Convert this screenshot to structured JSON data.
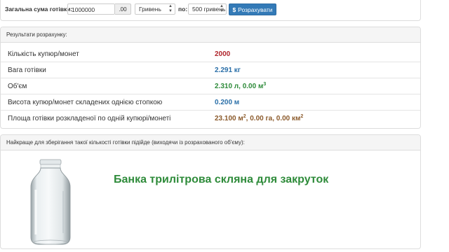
{
  "form": {
    "amount_label": "Загальна сума готівки:",
    "amount_value": "1000000",
    "decimals": ".00",
    "currency_selected": "Гривень",
    "by_label": "по:",
    "denomination_selected": "500 гривень",
    "calculate_label": "Розрахувати",
    "calculate_icon": "$"
  },
  "results": {
    "heading": "Результати розрахунку:",
    "rows": [
      {
        "label": "Кількість купюр/монет",
        "value": "2000",
        "color": "#b0262d"
      },
      {
        "label": "Вага готівки",
        "value": "2.291 кг",
        "color": "#2a6fa8"
      },
      {
        "label": "Об'єм",
        "value_main": "2.310 л, 0.00 м",
        "sup": "3",
        "color": "#2e8b3a"
      },
      {
        "label": "Висота купюр/монет складених однією стопкою",
        "value": "0.200 м",
        "color": "#2a6fa8"
      },
      {
        "label": "Площа готівки розкладеної по одній купюрі/монеті",
        "value_a": "23.100 м",
        "sup_a": "2",
        "value_b": ", 0.00 га, 0.00 км",
        "sup_b": "2",
        "color": "#8b5a2b"
      }
    ]
  },
  "storage": {
    "heading": "Найкраще для зберігання такої кількості готівки підійде (виходячи із розрахованого об'єму):",
    "product_name": "Банка трилітрова скляна для закруток",
    "image_icon": "glass-jar-image"
  }
}
